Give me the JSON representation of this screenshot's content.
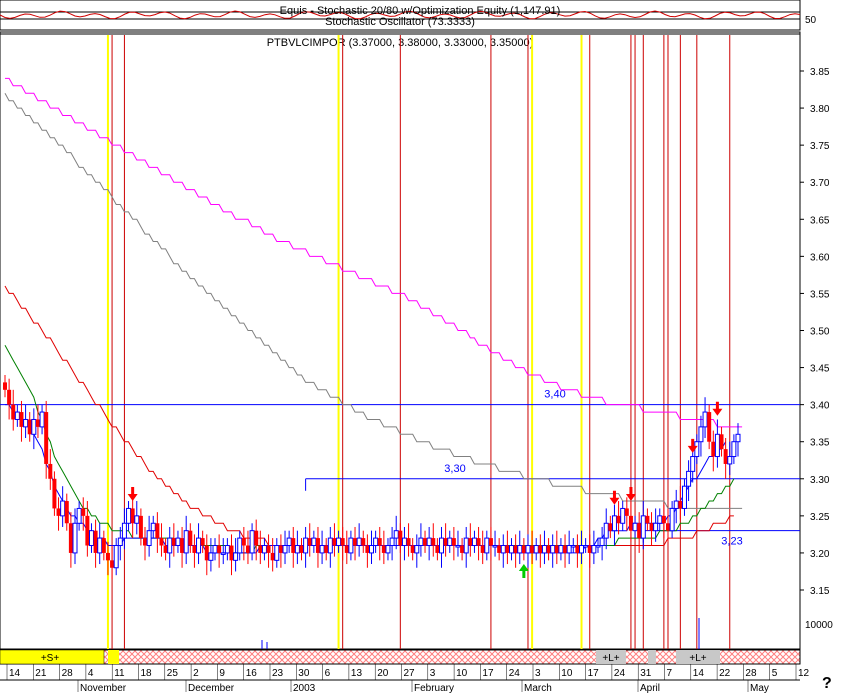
{
  "header": {
    "line1": "Equis - Stochastic 20/80 w/Optimization Equity (1,147.91)",
    "line2": "Stochastic Oscillator (73.3333)",
    "line3": "PTBVLCIMPOR (3.37000, 3.38000, 3.33000, 3.35000)",
    "oscillator_level": "50"
  },
  "chart_data": {
    "type": "candlestick",
    "symbol": "PTBVLCIMPOR",
    "last_ohlc": {
      "open": 3.37,
      "high": 3.38,
      "low": 3.33,
      "close": 3.35
    },
    "y_ticks": [
      "3.15",
      "3.20",
      "3.25",
      "3.30",
      "3.35",
      "3.40",
      "3.45",
      "3.50",
      "3.55",
      "3.60",
      "3.65",
      "3.70",
      "3.75",
      "3.80",
      "3.85"
    ],
    "ylim": [
      3.092,
      3.885
    ],
    "volume_label": "10000",
    "horizontal_levels": [
      {
        "value": 3.4,
        "label": "3,40",
        "from_day": 0
      },
      {
        "value": 3.3,
        "label": "3,30",
        "from_day": 73
      },
      {
        "value": 3.23,
        "label": "3,23",
        "from_day": 155
      }
    ],
    "x_day_labels": [
      "14",
      "21",
      "28",
      "4",
      "11",
      "18",
      "25",
      "2",
      "9",
      "16",
      "23",
      "30",
      "6",
      "13",
      "20",
      "27",
      "3",
      "10",
      "17",
      "24",
      "3",
      "10",
      "17",
      "24",
      "31",
      "7",
      "14",
      "22",
      "28",
      "5",
      "12"
    ],
    "month_labels": [
      "November",
      "December",
      "2003",
      "February",
      "March",
      "April",
      "May"
    ],
    "bands": [
      "+S+",
      "+L+",
      "+L+"
    ],
    "help_mark": "?",
    "red_verticals": [
      26,
      29,
      82,
      96,
      118,
      127,
      142,
      152,
      153,
      155,
      160,
      161,
      164,
      168,
      176
    ],
    "yellow_verticals": [
      25,
      81,
      128,
      140
    ],
    "sell_arrows": [
      [
        31,
        3.27
      ],
      [
        148,
        3.265
      ],
      [
        152,
        3.27
      ],
      [
        167,
        3.335
      ],
      [
        173,
        3.385
      ]
    ],
    "buy_arrows": [
      [
        126,
        3.185
      ]
    ],
    "close": [
      3.42,
      3.4,
      3.38,
      3.39,
      3.37,
      3.38,
      3.36,
      3.38,
      3.37,
      3.39,
      3.32,
      3.3,
      3.26,
      3.25,
      3.27,
      3.24,
      3.2,
      3.24,
      3.26,
      3.25,
      3.21,
      3.23,
      3.2,
      3.22,
      3.2,
      3.19,
      3.18,
      3.21,
      3.22,
      3.24,
      3.26,
      3.24,
      3.25,
      3.22,
      3.21,
      3.23,
      3.24,
      3.22,
      3.21,
      3.2,
      3.22,
      3.21,
      3.22,
      3.2,
      3.23,
      3.21,
      3.2,
      3.22,
      3.21,
      3.19,
      3.2,
      3.21,
      3.2,
      3.2,
      3.21,
      3.19,
      3.2,
      3.22,
      3.21,
      3.2,
      3.23,
      3.21,
      3.2,
      3.21,
      3.2,
      3.19,
      3.21,
      3.2,
      3.21,
      3.22,
      3.2,
      3.21,
      3.2,
      3.22,
      3.21,
      3.22,
      3.2,
      3.21,
      3.2,
      3.22,
      3.21,
      3.22,
      3.21,
      3.2,
      3.22,
      3.21,
      3.22,
      3.21,
      3.2,
      3.21,
      3.22,
      3.21,
      3.2,
      3.21,
      3.22,
      3.23,
      3.21,
      3.22,
      3.21,
      3.2,
      3.21,
      3.22,
      3.21,
      3.22,
      3.21,
      3.2,
      3.22,
      3.21,
      3.22,
      3.21,
      3.21,
      3.2,
      3.22,
      3.21,
      3.22,
      3.21,
      3.2,
      3.22,
      3.21,
      3.21,
      3.2,
      3.21,
      3.2,
      3.21,
      3.2,
      3.21,
      3.2,
      3.21,
      3.2,
      3.21,
      3.2,
      3.21,
      3.2,
      3.21,
      3.2,
      3.21,
      3.2,
      3.21,
      3.21,
      3.2,
      3.21,
      3.21,
      3.2,
      3.21,
      3.21,
      3.22,
      3.24,
      3.23,
      3.25,
      3.24,
      3.26,
      3.25,
      3.23,
      3.24,
      3.22,
      3.25,
      3.24,
      3.23,
      3.24,
      3.25,
      3.24,
      3.23,
      3.26,
      3.27,
      3.26,
      3.29,
      3.31,
      3.33,
      3.35,
      3.37,
      3.39,
      3.35,
      3.33,
      3.36,
      3.34,
      3.32,
      3.33,
      3.35,
      3.36
    ],
    "ma_blue": [
      3.4,
      3.4,
      3.39,
      3.39,
      3.38,
      3.38,
      3.37,
      3.36,
      3.35,
      3.34,
      3.32,
      3.31,
      3.29,
      3.28,
      3.27,
      3.26,
      3.25,
      3.25,
      3.24,
      3.24,
      3.23,
      3.23,
      3.22,
      3.22,
      3.22,
      3.21,
      3.21,
      3.21,
      3.21,
      3.22,
      3.22,
      3.22,
      3.22,
      3.22,
      3.22,
      3.22,
      3.22,
      3.22,
      3.22,
      3.21,
      3.21,
      3.21,
      3.21,
      3.21,
      3.21,
      3.21,
      3.21,
      3.21,
      3.21,
      3.2,
      3.2,
      3.2,
      3.2,
      3.2,
      3.2,
      3.2,
      3.2,
      3.2,
      3.2,
      3.2,
      3.2,
      3.2,
      3.21,
      3.21,
      3.21,
      3.21,
      3.21,
      3.21,
      3.21,
      3.21,
      3.21,
      3.21,
      3.21,
      3.21,
      3.21,
      3.21,
      3.21,
      3.21,
      3.21,
      3.21,
      3.21,
      3.21,
      3.21,
      3.21,
      3.21,
      3.21,
      3.21,
      3.21,
      3.21,
      3.21,
      3.21,
      3.21,
      3.21,
      3.21,
      3.21,
      3.21,
      3.21,
      3.21,
      3.21,
      3.21,
      3.21,
      3.21,
      3.21,
      3.21,
      3.21,
      3.21,
      3.21,
      3.21,
      3.21,
      3.21,
      3.21,
      3.21,
      3.21,
      3.21,
      3.21,
      3.21,
      3.21,
      3.21,
      3.21,
      3.21,
      3.21,
      3.21,
      3.21,
      3.2,
      3.2,
      3.2,
      3.2,
      3.2,
      3.2,
      3.2,
      3.2,
      3.2,
      3.2,
      3.2,
      3.2,
      3.2,
      3.2,
      3.2,
      3.2,
      3.2,
      3.2,
      3.21,
      3.21,
      3.21,
      3.22,
      3.22,
      3.23,
      3.23,
      3.23,
      3.23,
      3.23,
      3.23,
      3.24,
      3.24,
      3.24,
      3.24,
      3.24,
      3.24,
      3.24,
      3.24,
      3.24,
      3.25,
      3.25,
      3.26,
      3.27,
      3.28,
      3.29,
      3.3,
      3.3,
      3.31,
      3.32,
      3.33,
      3.33,
      3.34,
      3.34,
      3.35
    ],
    "ma_green": [
      3.48,
      3.47,
      3.46,
      3.45,
      3.44,
      3.43,
      3.42,
      3.41,
      3.39,
      3.38,
      3.36,
      3.35,
      3.33,
      3.32,
      3.31,
      3.3,
      3.29,
      3.28,
      3.27,
      3.26,
      3.26,
      3.25,
      3.25,
      3.24,
      3.24,
      3.24,
      3.23,
      3.23,
      3.23,
      3.23,
      3.23,
      3.22,
      3.22,
      3.22,
      3.22,
      3.22,
      3.22,
      3.22,
      3.22,
      3.22,
      3.22,
      3.22,
      3.21,
      3.21,
      3.21,
      3.21,
      3.21,
      3.21,
      3.21,
      3.21,
      3.21,
      3.21,
      3.21,
      3.21,
      3.21,
      3.2,
      3.2,
      3.2,
      3.2,
      3.2,
      3.2,
      3.21,
      3.21,
      3.21,
      3.21,
      3.21,
      3.21,
      3.21,
      3.21,
      3.21,
      3.21,
      3.21,
      3.21,
      3.21,
      3.21,
      3.21,
      3.21,
      3.21,
      3.21,
      3.21,
      3.21,
      3.21,
      3.21,
      3.21,
      3.21,
      3.21,
      3.21,
      3.21,
      3.21,
      3.21,
      3.21,
      3.21,
      3.21,
      3.21,
      3.21,
      3.21,
      3.21,
      3.21,
      3.21,
      3.21,
      3.21,
      3.21,
      3.21,
      3.21,
      3.21,
      3.21,
      3.21,
      3.21,
      3.21,
      3.21,
      3.21,
      3.21,
      3.21,
      3.21,
      3.21,
      3.21,
      3.21,
      3.21,
      3.21,
      3.21,
      3.21,
      3.21,
      3.21,
      3.21,
      3.21,
      3.21,
      3.21,
      3.21,
      3.21,
      3.21,
      3.21,
      3.21,
      3.21,
      3.21,
      3.21,
      3.21,
      3.21,
      3.21,
      3.21,
      3.21,
      3.21,
      3.21,
      3.21,
      3.21,
      3.21,
      3.21,
      3.21,
      3.21,
      3.21,
      3.22,
      3.22,
      3.22,
      3.22,
      3.22,
      3.22,
      3.22,
      3.22,
      3.22,
      3.22,
      3.23,
      3.23,
      3.23,
      3.23,
      3.23,
      3.24,
      3.24,
      3.24,
      3.25,
      3.25,
      3.26,
      3.26,
      3.27,
      3.27,
      3.28,
      3.28,
      3.29,
      3.29,
      3.3
    ],
    "ma_red": [
      3.56,
      3.55,
      3.55,
      3.54,
      3.53,
      3.53,
      3.52,
      3.51,
      3.51,
      3.5,
      3.49,
      3.49,
      3.48,
      3.47,
      3.46,
      3.46,
      3.45,
      3.44,
      3.43,
      3.43,
      3.42,
      3.41,
      3.4,
      3.4,
      3.39,
      3.38,
      3.37,
      3.37,
      3.36,
      3.35,
      3.35,
      3.34,
      3.33,
      3.33,
      3.32,
      3.31,
      3.31,
      3.3,
      3.3,
      3.29,
      3.29,
      3.28,
      3.28,
      3.27,
      3.27,
      3.26,
      3.26,
      3.26,
      3.25,
      3.25,
      3.25,
      3.24,
      3.24,
      3.24,
      3.23,
      3.23,
      3.23,
      3.23,
      3.22,
      3.22,
      3.22,
      3.22,
      3.22,
      3.22,
      3.21,
      3.21,
      3.21,
      3.21,
      3.21,
      3.21,
      3.21,
      3.21,
      3.21,
      3.21,
      3.21,
      3.21,
      3.21,
      3.21,
      3.21,
      3.21,
      3.21,
      3.21,
      3.21,
      3.21,
      3.21,
      3.21,
      3.21,
      3.21,
      3.21,
      3.21,
      3.21,
      3.21,
      3.21,
      3.21,
      3.21,
      3.21,
      3.21,
      3.21,
      3.21,
      3.21,
      3.21,
      3.21,
      3.21,
      3.21,
      3.21,
      3.21,
      3.21,
      3.21,
      3.21,
      3.21,
      3.21,
      3.21,
      3.21,
      3.21,
      3.21,
      3.21,
      3.21,
      3.21,
      3.21,
      3.21,
      3.21,
      3.21,
      3.21,
      3.21,
      3.21,
      3.21,
      3.21,
      3.21,
      3.21,
      3.21,
      3.21,
      3.21,
      3.21,
      3.21,
      3.21,
      3.21,
      3.21,
      3.21,
      3.21,
      3.21,
      3.21,
      3.21,
      3.21,
      3.21,
      3.21,
      3.21,
      3.21,
      3.21,
      3.21,
      3.21,
      3.21,
      3.21,
      3.21,
      3.21,
      3.21,
      3.21,
      3.21,
      3.21,
      3.21,
      3.21,
      3.21,
      3.22,
      3.22,
      3.22,
      3.22,
      3.22,
      3.22,
      3.22,
      3.23,
      3.23,
      3.23,
      3.23,
      3.24,
      3.24,
      3.24,
      3.24,
      3.25,
      3.25
    ],
    "ma_gray": [
      3.82,
      3.81,
      3.81,
      3.8,
      3.8,
      3.79,
      3.79,
      3.78,
      3.78,
      3.77,
      3.77,
      3.76,
      3.76,
      3.75,
      3.75,
      3.74,
      3.74,
      3.73,
      3.72,
      3.72,
      3.71,
      3.71,
      3.7,
      3.7,
      3.69,
      3.69,
      3.68,
      3.67,
      3.67,
      3.66,
      3.66,
      3.65,
      3.65,
      3.64,
      3.63,
      3.63,
      3.62,
      3.62,
      3.61,
      3.61,
      3.6,
      3.59,
      3.59,
      3.58,
      3.58,
      3.57,
      3.57,
      3.56,
      3.56,
      3.55,
      3.55,
      3.54,
      3.54,
      3.53,
      3.53,
      3.52,
      3.52,
      3.51,
      3.51,
      3.5,
      3.5,
      3.49,
      3.49,
      3.48,
      3.48,
      3.47,
      3.47,
      3.46,
      3.46,
      3.45,
      3.45,
      3.44,
      3.44,
      3.43,
      3.43,
      3.43,
      3.42,
      3.42,
      3.42,
      3.41,
      3.41,
      3.41,
      3.4,
      3.4,
      3.4,
      3.39,
      3.39,
      3.39,
      3.38,
      3.38,
      3.38,
      3.38,
      3.37,
      3.37,
      3.37,
      3.37,
      3.36,
      3.36,
      3.36,
      3.36,
      3.35,
      3.35,
      3.35,
      3.35,
      3.34,
      3.34,
      3.34,
      3.34,
      3.34,
      3.33,
      3.33,
      3.33,
      3.33,
      3.33,
      3.32,
      3.32,
      3.32,
      3.32,
      3.32,
      3.32,
      3.31,
      3.31,
      3.31,
      3.31,
      3.31,
      3.31,
      3.3,
      3.3,
      3.3,
      3.3,
      3.3,
      3.3,
      3.3,
      3.29,
      3.29,
      3.29,
      3.29,
      3.29,
      3.29,
      3.29,
      3.29,
      3.28,
      3.28,
      3.28,
      3.28,
      3.28,
      3.28,
      3.28,
      3.28,
      3.28,
      3.27,
      3.27,
      3.27,
      3.27,
      3.27,
      3.27,
      3.27,
      3.27,
      3.27,
      3.27,
      3.27,
      3.26,
      3.26,
      3.26,
      3.26,
      3.26,
      3.26,
      3.26,
      3.26,
      3.26,
      3.26,
      3.26,
      3.26,
      3.26,
      3.26,
      3.26,
      3.26,
      3.26,
      3.26,
      3.26
    ],
    "ma_magenta": [
      3.84,
      3.84,
      3.83,
      3.83,
      3.83,
      3.82,
      3.82,
      3.82,
      3.81,
      3.81,
      3.81,
      3.8,
      3.8,
      3.8,
      3.79,
      3.79,
      3.79,
      3.78,
      3.78,
      3.78,
      3.77,
      3.77,
      3.77,
      3.76,
      3.76,
      3.76,
      3.75,
      3.75,
      3.75,
      3.74,
      3.74,
      3.74,
      3.73,
      3.73,
      3.73,
      3.72,
      3.72,
      3.72,
      3.71,
      3.71,
      3.71,
      3.7,
      3.7,
      3.7,
      3.69,
      3.69,
      3.69,
      3.68,
      3.68,
      3.68,
      3.67,
      3.67,
      3.67,
      3.66,
      3.66,
      3.66,
      3.65,
      3.65,
      3.65,
      3.65,
      3.64,
      3.64,
      3.64,
      3.63,
      3.63,
      3.63,
      3.62,
      3.62,
      3.62,
      3.62,
      3.61,
      3.61,
      3.61,
      3.61,
      3.6,
      3.6,
      3.6,
      3.6,
      3.59,
      3.59,
      3.59,
      3.59,
      3.58,
      3.58,
      3.58,
      3.58,
      3.57,
      3.57,
      3.57,
      3.57,
      3.56,
      3.56,
      3.56,
      3.56,
      3.55,
      3.55,
      3.55,
      3.55,
      3.54,
      3.54,
      3.54,
      3.53,
      3.53,
      3.53,
      3.52,
      3.52,
      3.52,
      3.51,
      3.51,
      3.51,
      3.5,
      3.5,
      3.5,
      3.49,
      3.49,
      3.48,
      3.48,
      3.48,
      3.47,
      3.47,
      3.47,
      3.46,
      3.46,
      3.46,
      3.45,
      3.45,
      3.45,
      3.44,
      3.44,
      3.44,
      3.44,
      3.43,
      3.43,
      3.43,
      3.43,
      3.42,
      3.42,
      3.42,
      3.42,
      3.42,
      3.41,
      3.41,
      3.41,
      3.41,
      3.41,
      3.41,
      3.4,
      3.4,
      3.4,
      3.4,
      3.4,
      3.4,
      3.4,
      3.4,
      3.4,
      3.39,
      3.39,
      3.39,
      3.39,
      3.39,
      3.39,
      3.39,
      3.39,
      3.39,
      3.38,
      3.38,
      3.38,
      3.38,
      3.38,
      3.38,
      3.38,
      3.38,
      3.38,
      3.37,
      3.37,
      3.37,
      3.37,
      3.37,
      3.37,
      3.37
    ],
    "colors": {
      "up": "#0000ff",
      "down": "#ff0000",
      "ma_blue": "#0000ff",
      "ma_green": "#008000",
      "ma_red": "#e00000",
      "ma_gray": "#808080",
      "ma_magenta": "#ff00ff",
      "level_line": "#0000ff",
      "signal_red": "#cc0000",
      "signal_yellow": "#ffff00",
      "band_yellow": "#ffff00",
      "band_hatch": "#ff8080"
    }
  }
}
